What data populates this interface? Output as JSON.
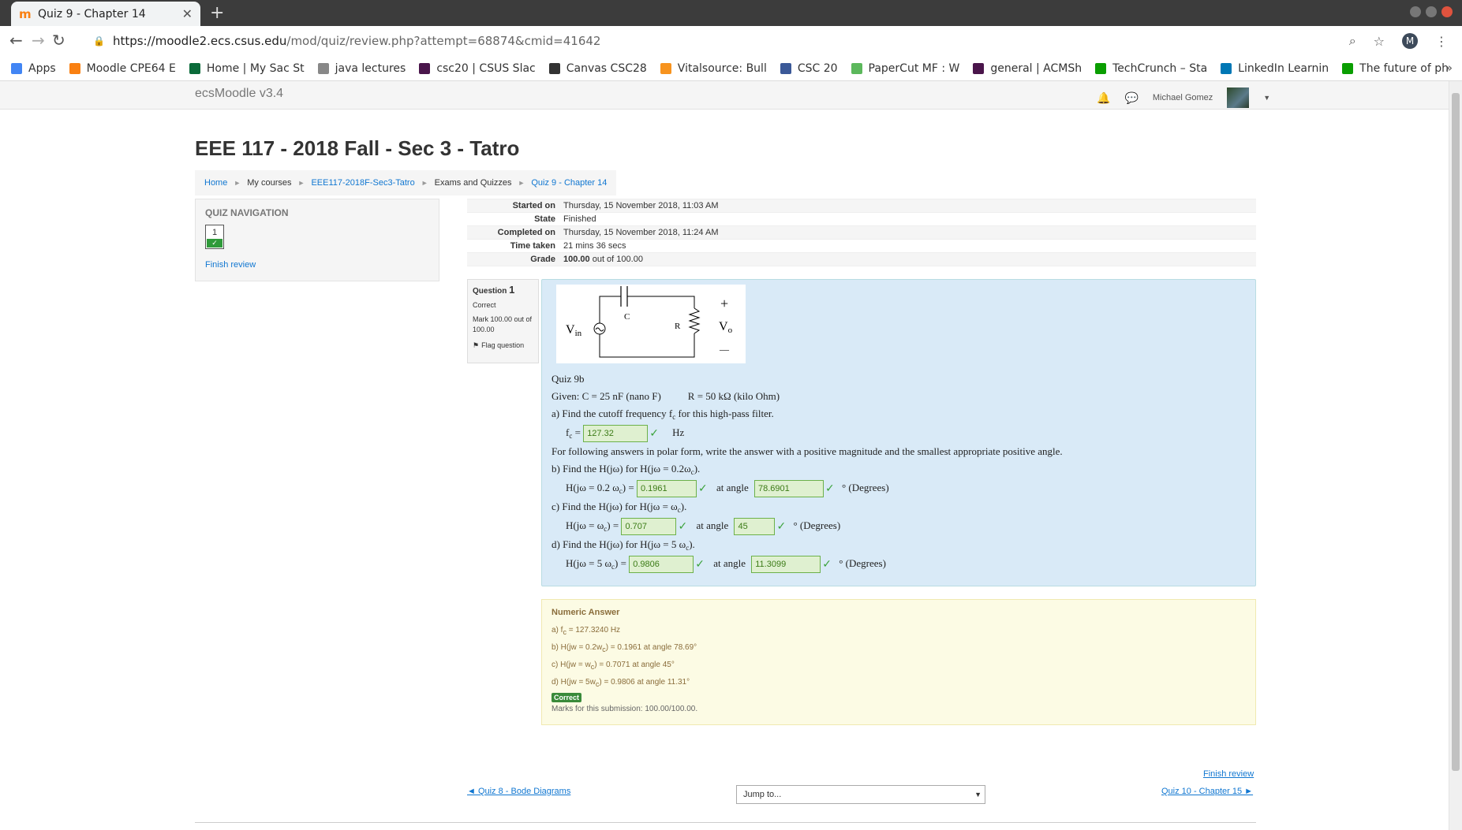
{
  "browser": {
    "tab_title": "Quiz 9 - Chapter 14",
    "url_host": "https://moodle2.ecs.csus.edu",
    "url_path": "/mod/quiz/review.php?attempt=68874&cmid=41642",
    "profile_initial": "M",
    "bookmarks": [
      {
        "label": "Apps",
        "color": "#4285f4"
      },
      {
        "label": "Moodle CPE64 E",
        "color": "#f98012"
      },
      {
        "label": "Home | My Sac St",
        "color": "#0b6b3a"
      },
      {
        "label": "java lectures",
        "color": "#888888"
      },
      {
        "label": "csc20 | CSUS Slac",
        "color": "#4a154b"
      },
      {
        "label": "Canvas CSC28",
        "color": "#333333"
      },
      {
        "label": "Vitalsource: Bull",
        "color": "#f7931e"
      },
      {
        "label": "CSC 20",
        "color": "#3b5998"
      },
      {
        "label": "PaperCut MF : W",
        "color": "#5cb85c"
      },
      {
        "label": "general | ACMSh",
        "color": "#4a154b"
      },
      {
        "label": "TechCrunch – Sta",
        "color": "#0a9e01"
      },
      {
        "label": "LinkedIn Learnin",
        "color": "#0077b5"
      },
      {
        "label": "The future of ph",
        "color": "#0a9e01"
      }
    ]
  },
  "moodle": {
    "site_name": "ecsMoodle v3.4",
    "user_name": "Michael Gomez"
  },
  "page": {
    "title": "EEE 117 - 2018 Fall - Sec 3 - Tatro",
    "breadcrumb": [
      "Home",
      "My courses",
      "EEE117-2018F-Sec3-Tatro",
      "Exams and Quizzes",
      "Quiz 9 - Chapter 14"
    ]
  },
  "quiz_nav": {
    "heading": "QUIZ NAVIGATION",
    "question_number": "1",
    "finish_review": "Finish review"
  },
  "summary": [
    {
      "label": "Started on",
      "value": "Thursday, 15 November 2018, 11:03 AM"
    },
    {
      "label": "State",
      "value": "Finished"
    },
    {
      "label": "Completed on",
      "value": "Thursday, 15 November 2018, 11:24 AM"
    },
    {
      "label": "Time taken",
      "value": "21 mins 36 secs"
    },
    {
      "label": "Grade",
      "value_bold": "100.00",
      "value": " out of 100.00"
    }
  ],
  "question_info": {
    "label": "Question",
    "number": "1",
    "status": "Correct",
    "mark": "Mark 100.00 out of 100.00",
    "flag": "Flag question"
  },
  "circuit": {
    "vin": "V",
    "vin_sub": "in",
    "c": "C",
    "r": "R",
    "vo": "V",
    "vo_sub": "o",
    "plus": "+",
    "minus": "—"
  },
  "question": {
    "title": "Quiz 9b",
    "given_c": "Given: C = 25 nF (nano F)",
    "given_r": "R = 50 kΩ (kilo Ohm)",
    "a_text": "a)  Find the cutoff frequency f",
    "a_text_sub": "c",
    "a_text_end": " for this high-pass filter.",
    "a_label": "f",
    "a_label_sub": "c",
    "a_eq": " = ",
    "a_answer": "127.32",
    "a_unit": "Hz",
    "polar_note": "For following answers in polar form, write the answer with a positive magnitude and the smallest appropriate positive angle.",
    "b_text": "b)  Find the H(jω) for H(jω = 0.2ω",
    "b_text_sub": "c",
    "b_text_end": ").",
    "b_label": "H(jω = 0.2 ω",
    "b_label_sub": "c",
    "b_label_end": ") = ",
    "b_mag": "0.1961",
    "b_angle": "78.6901",
    "c_text": "c)  Find the H(jω) for H(jω = ω",
    "c_text_sub": "c",
    "c_text_end": ").",
    "c_label": "H(jω = ω",
    "c_label_sub": "c",
    "c_label_end": ") = ",
    "c_mag": "0.707",
    "c_angle": "45",
    "d_text": "d)  Find the H(jω) for H(jω = 5 ω",
    "d_text_sub": "c",
    "d_text_end": ").",
    "d_label": "H(jω = 5 ω",
    "d_label_sub": "c",
    "d_label_end": ") = ",
    "d_mag": "0.9806",
    "d_angle": "11.3099",
    "at_angle": "at angle",
    "degrees": "° (Degrees)",
    "check": "✓"
  },
  "feedback": {
    "heading": "Numeric Answer",
    "a_pre": "a)  f",
    "a_sub": "c",
    "a_post": " = 127.3240 Hz",
    "b_pre": "b)  H(jw = 0.2w",
    "b_sub": "c",
    "b_post": ") = 0.1961 at angle 78.69°",
    "c_pre": "c)  H(jw = w",
    "c_sub": "c",
    "c_post": ") = 0.7071 at angle 45°",
    "d_pre": "d)  H(jw = 5w",
    "d_sub": "c",
    "d_post": ") = 0.9806 at angle 11.31°",
    "badge": "Correct",
    "marks": "Marks for this submission: 100.00/100.00."
  },
  "footer": {
    "finish_review": "Finish review",
    "prev": "◄ Quiz 8 - Bode Diagrams",
    "jump": "Jump to...",
    "next": "Quiz 10 - Chapter 15 ►"
  }
}
